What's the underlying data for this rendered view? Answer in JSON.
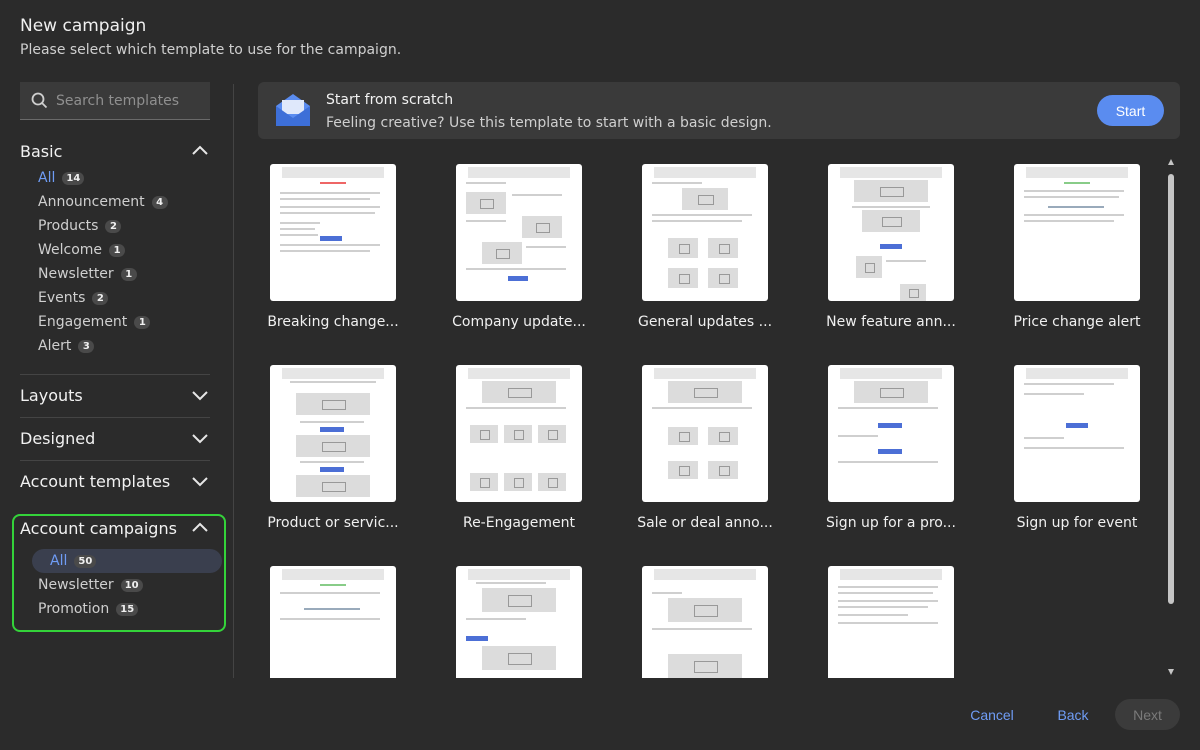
{
  "header": {
    "title": "New campaign",
    "subtitle": "Please select which template to use for the campaign."
  },
  "search": {
    "placeholder": "Search templates"
  },
  "sidebar": {
    "basic": {
      "title": "Basic",
      "items": [
        {
          "label": "All",
          "count": "14"
        },
        {
          "label": "Announcement",
          "count": "4"
        },
        {
          "label": "Products",
          "count": "2"
        },
        {
          "label": "Welcome",
          "count": "1"
        },
        {
          "label": "Newsletter",
          "count": "1"
        },
        {
          "label": "Events",
          "count": "2"
        },
        {
          "label": "Engagement",
          "count": "1"
        },
        {
          "label": "Alert",
          "count": "3"
        }
      ]
    },
    "layouts": "Layouts",
    "designed": "Designed",
    "account_templates": "Account templates",
    "account_campaigns": {
      "title": "Account campaigns",
      "items": [
        {
          "label": "All",
          "count": "50"
        },
        {
          "label": "Newsletter",
          "count": "10"
        },
        {
          "label": "Promotion",
          "count": "15"
        }
      ]
    }
  },
  "scratch": {
    "title": "Start from scratch",
    "description": "Feeling creative? Use this template to start with a basic design.",
    "button": "Start"
  },
  "templates": [
    {
      "label": "Breaking change..."
    },
    {
      "label": "Company update..."
    },
    {
      "label": "General updates ..."
    },
    {
      "label": "New feature ann..."
    },
    {
      "label": "Price change alert"
    },
    {
      "label": "Product or servic..."
    },
    {
      "label": "Re-Engagement"
    },
    {
      "label": "Sale or deal anno..."
    },
    {
      "label": "Sign up for a pro..."
    },
    {
      "label": "Sign up for event"
    },
    {
      "label": ""
    },
    {
      "label": ""
    },
    {
      "label": ""
    },
    {
      "label": ""
    }
  ],
  "footer": {
    "cancel": "Cancel",
    "back": "Back",
    "next": "Next"
  },
  "colors": {
    "accent": "#5a8cf0",
    "highlight": "#34d33a",
    "background": "#2b2b2b"
  }
}
